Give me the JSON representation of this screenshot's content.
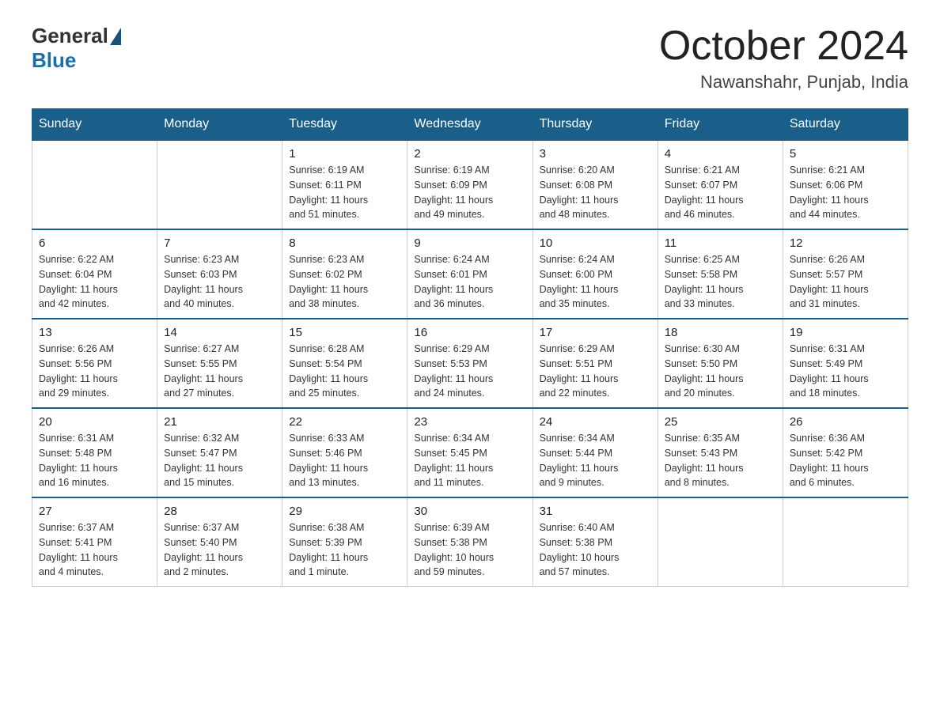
{
  "logo": {
    "general": "General",
    "blue": "Blue"
  },
  "title": "October 2024",
  "location": "Nawanshahr, Punjab, India",
  "headers": [
    "Sunday",
    "Monday",
    "Tuesday",
    "Wednesday",
    "Thursday",
    "Friday",
    "Saturday"
  ],
  "weeks": [
    [
      {
        "day": "",
        "info": ""
      },
      {
        "day": "",
        "info": ""
      },
      {
        "day": "1",
        "info": "Sunrise: 6:19 AM\nSunset: 6:11 PM\nDaylight: 11 hours\nand 51 minutes."
      },
      {
        "day": "2",
        "info": "Sunrise: 6:19 AM\nSunset: 6:09 PM\nDaylight: 11 hours\nand 49 minutes."
      },
      {
        "day": "3",
        "info": "Sunrise: 6:20 AM\nSunset: 6:08 PM\nDaylight: 11 hours\nand 48 minutes."
      },
      {
        "day": "4",
        "info": "Sunrise: 6:21 AM\nSunset: 6:07 PM\nDaylight: 11 hours\nand 46 minutes."
      },
      {
        "day": "5",
        "info": "Sunrise: 6:21 AM\nSunset: 6:06 PM\nDaylight: 11 hours\nand 44 minutes."
      }
    ],
    [
      {
        "day": "6",
        "info": "Sunrise: 6:22 AM\nSunset: 6:04 PM\nDaylight: 11 hours\nand 42 minutes."
      },
      {
        "day": "7",
        "info": "Sunrise: 6:23 AM\nSunset: 6:03 PM\nDaylight: 11 hours\nand 40 minutes."
      },
      {
        "day": "8",
        "info": "Sunrise: 6:23 AM\nSunset: 6:02 PM\nDaylight: 11 hours\nand 38 minutes."
      },
      {
        "day": "9",
        "info": "Sunrise: 6:24 AM\nSunset: 6:01 PM\nDaylight: 11 hours\nand 36 minutes."
      },
      {
        "day": "10",
        "info": "Sunrise: 6:24 AM\nSunset: 6:00 PM\nDaylight: 11 hours\nand 35 minutes."
      },
      {
        "day": "11",
        "info": "Sunrise: 6:25 AM\nSunset: 5:58 PM\nDaylight: 11 hours\nand 33 minutes."
      },
      {
        "day": "12",
        "info": "Sunrise: 6:26 AM\nSunset: 5:57 PM\nDaylight: 11 hours\nand 31 minutes."
      }
    ],
    [
      {
        "day": "13",
        "info": "Sunrise: 6:26 AM\nSunset: 5:56 PM\nDaylight: 11 hours\nand 29 minutes."
      },
      {
        "day": "14",
        "info": "Sunrise: 6:27 AM\nSunset: 5:55 PM\nDaylight: 11 hours\nand 27 minutes."
      },
      {
        "day": "15",
        "info": "Sunrise: 6:28 AM\nSunset: 5:54 PM\nDaylight: 11 hours\nand 25 minutes."
      },
      {
        "day": "16",
        "info": "Sunrise: 6:29 AM\nSunset: 5:53 PM\nDaylight: 11 hours\nand 24 minutes."
      },
      {
        "day": "17",
        "info": "Sunrise: 6:29 AM\nSunset: 5:51 PM\nDaylight: 11 hours\nand 22 minutes."
      },
      {
        "day": "18",
        "info": "Sunrise: 6:30 AM\nSunset: 5:50 PM\nDaylight: 11 hours\nand 20 minutes."
      },
      {
        "day": "19",
        "info": "Sunrise: 6:31 AM\nSunset: 5:49 PM\nDaylight: 11 hours\nand 18 minutes."
      }
    ],
    [
      {
        "day": "20",
        "info": "Sunrise: 6:31 AM\nSunset: 5:48 PM\nDaylight: 11 hours\nand 16 minutes."
      },
      {
        "day": "21",
        "info": "Sunrise: 6:32 AM\nSunset: 5:47 PM\nDaylight: 11 hours\nand 15 minutes."
      },
      {
        "day": "22",
        "info": "Sunrise: 6:33 AM\nSunset: 5:46 PM\nDaylight: 11 hours\nand 13 minutes."
      },
      {
        "day": "23",
        "info": "Sunrise: 6:34 AM\nSunset: 5:45 PM\nDaylight: 11 hours\nand 11 minutes."
      },
      {
        "day": "24",
        "info": "Sunrise: 6:34 AM\nSunset: 5:44 PM\nDaylight: 11 hours\nand 9 minutes."
      },
      {
        "day": "25",
        "info": "Sunrise: 6:35 AM\nSunset: 5:43 PM\nDaylight: 11 hours\nand 8 minutes."
      },
      {
        "day": "26",
        "info": "Sunrise: 6:36 AM\nSunset: 5:42 PM\nDaylight: 11 hours\nand 6 minutes."
      }
    ],
    [
      {
        "day": "27",
        "info": "Sunrise: 6:37 AM\nSunset: 5:41 PM\nDaylight: 11 hours\nand 4 minutes."
      },
      {
        "day": "28",
        "info": "Sunrise: 6:37 AM\nSunset: 5:40 PM\nDaylight: 11 hours\nand 2 minutes."
      },
      {
        "day": "29",
        "info": "Sunrise: 6:38 AM\nSunset: 5:39 PM\nDaylight: 11 hours\nand 1 minute."
      },
      {
        "day": "30",
        "info": "Sunrise: 6:39 AM\nSunset: 5:38 PM\nDaylight: 10 hours\nand 59 minutes."
      },
      {
        "day": "31",
        "info": "Sunrise: 6:40 AM\nSunset: 5:38 PM\nDaylight: 10 hours\nand 57 minutes."
      },
      {
        "day": "",
        "info": ""
      },
      {
        "day": "",
        "info": ""
      }
    ]
  ]
}
